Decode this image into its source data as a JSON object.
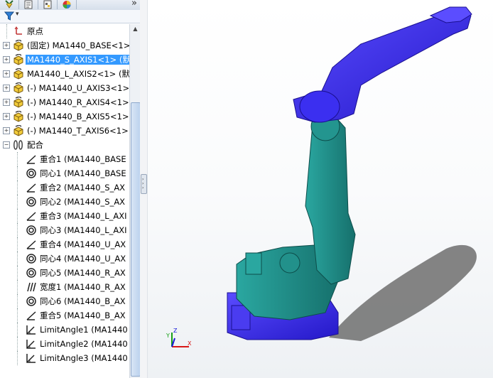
{
  "panel": {
    "tabs": [
      {
        "name": "feature-manager",
        "icon": "feature-tree-icon"
      },
      {
        "name": "property-manager",
        "icon": "property-manager-icon"
      },
      {
        "name": "configuration-manager",
        "icon": "configuration-icon"
      },
      {
        "name": "display-manager",
        "icon": "appearance-icon"
      }
    ],
    "more_label": "»",
    "filter_caret": "▾"
  },
  "tree": {
    "items": [
      {
        "label": "原点",
        "icon": "origin-icon",
        "indent": 1,
        "expander": ""
      },
      {
        "label": "(固定) MA1440_BASE<1>",
        "icon": "part-icon",
        "indent": 0,
        "expander": "+"
      },
      {
        "label": "MA1440_S_AXIS1<1> (默",
        "icon": "part-icon",
        "indent": 0,
        "expander": "+",
        "selected": true
      },
      {
        "label": "MA1440_L_AXIS2<1> (默",
        "icon": "part-icon",
        "indent": 0,
        "expander": "+"
      },
      {
        "label": "(-) MA1440_U_AXIS3<1>",
        "icon": "part-icon",
        "indent": 0,
        "expander": "+"
      },
      {
        "label": "(-) MA1440_R_AXIS4<1>",
        "icon": "part-icon",
        "indent": 0,
        "expander": "+"
      },
      {
        "label": "(-) MA1440_B_AXIS5<1>",
        "icon": "part-icon",
        "indent": 0,
        "expander": "+"
      },
      {
        "label": "(-) MA1440_T_AXIS6<1>",
        "icon": "part-icon",
        "indent": 0,
        "expander": "+"
      },
      {
        "label": "配合",
        "icon": "mates-folder-icon",
        "indent": 0,
        "expander": "−"
      },
      {
        "label": "重合1 (MA1440_BASE",
        "icon": "coincident-mate-icon",
        "indent": 2,
        "expander": ""
      },
      {
        "label": "同心1 (MA1440_BASE",
        "icon": "concentric-mate-icon",
        "indent": 2,
        "expander": ""
      },
      {
        "label": "重合2 (MA1440_S_AX",
        "icon": "coincident-mate-icon",
        "indent": 2,
        "expander": ""
      },
      {
        "label": "同心2 (MA1440_S_AX",
        "icon": "concentric-mate-icon",
        "indent": 2,
        "expander": ""
      },
      {
        "label": "重合3 (MA1440_L_AXI",
        "icon": "coincident-mate-icon",
        "indent": 2,
        "expander": ""
      },
      {
        "label": "同心3 (MA1440_L_AXI",
        "icon": "concentric-mate-icon",
        "indent": 2,
        "expander": ""
      },
      {
        "label": "重合4 (MA1440_U_AX",
        "icon": "coincident-mate-icon",
        "indent": 2,
        "expander": ""
      },
      {
        "label": "同心4 (MA1440_U_AX",
        "icon": "concentric-mate-icon",
        "indent": 2,
        "expander": ""
      },
      {
        "label": "同心5 (MA1440_R_AX",
        "icon": "concentric-mate-icon",
        "indent": 2,
        "expander": ""
      },
      {
        "label": "宽度1 (MA1440_R_AX",
        "icon": "width-mate-icon",
        "indent": 2,
        "expander": ""
      },
      {
        "label": "同心6 (MA1440_B_AX",
        "icon": "concentric-mate-icon",
        "indent": 2,
        "expander": ""
      },
      {
        "label": "重合5 (MA1440_B_AX",
        "icon": "coincident-mate-icon",
        "indent": 2,
        "expander": ""
      },
      {
        "label": "LimitAngle1 (MA1440",
        "icon": "limit-angle-mate-icon",
        "indent": 2,
        "expander": ""
      },
      {
        "label": "LimitAngle2 (MA1440",
        "icon": "limit-angle-mate-icon",
        "indent": 2,
        "expander": ""
      },
      {
        "label": "LimitAngle3 (MA1440",
        "icon": "limit-angle-mate-icon",
        "indent": 2,
        "expander": ""
      }
    ]
  },
  "scrollbar": {
    "up_arrow": "▲"
  },
  "splitter": {
    "arrows": [
      "›",
      "›",
      "›"
    ]
  },
  "viewport": {
    "model": "robot-arm-model",
    "colors": {
      "blue": "#3d2df0",
      "teal": "#1f8f8a",
      "shadow": "#6f6f6f"
    },
    "triad": {
      "x_label": "X",
      "y_label": "Y",
      "z_label": "Z"
    }
  }
}
